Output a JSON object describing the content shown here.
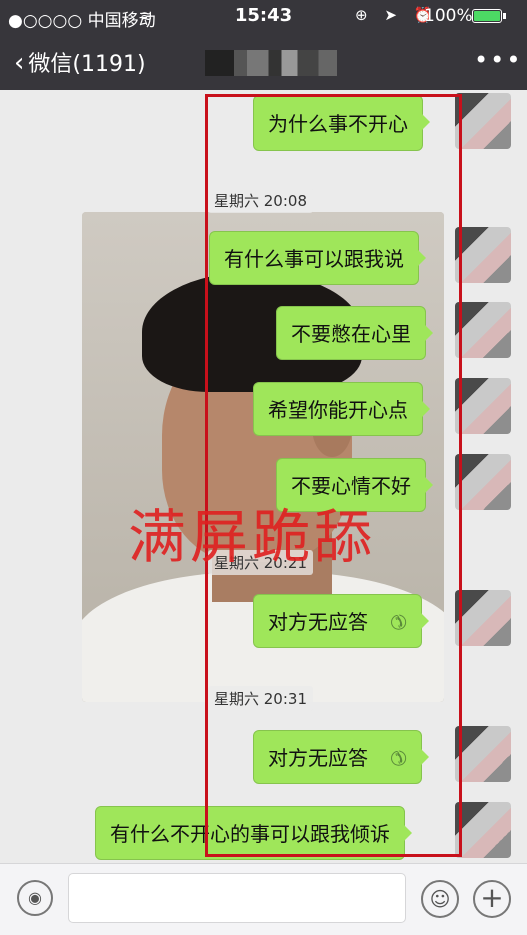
{
  "status_bar": {
    "carrier": "●○○○○ 中国移动",
    "wifi_icon": "wifi-icon",
    "time": "15:43",
    "icons": "⊕ ➤ ⏰",
    "battery_text": "100%"
  },
  "nav": {
    "back_label": "微信(1191)",
    "more_label": "•••"
  },
  "messages": [
    {
      "text": "为什么事不开心"
    },
    {
      "text": "有什么事可以跟我说"
    },
    {
      "text": "不要憋在心里"
    },
    {
      "text": "希望你能开心点"
    },
    {
      "text": "不要心情不好"
    },
    {
      "text": "对方无应答"
    },
    {
      "text": "对方无应答"
    },
    {
      "text": "有什么不开心的事可以跟我倾诉"
    }
  ],
  "timestamps": [
    "星期六 20:08",
    "星期六 20:21",
    "星期六 20:31"
  ],
  "overlay_caption": "满屏跪舔",
  "colors": {
    "bubble": "#9fe65a",
    "nav_bg": "#37363b",
    "chat_bg": "#ebebeb",
    "annotation_red": "#c8101b"
  }
}
